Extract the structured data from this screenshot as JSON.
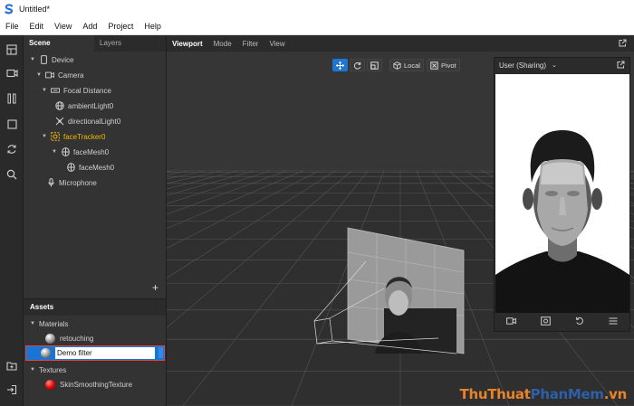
{
  "window": {
    "title": "Untitled*"
  },
  "menu": [
    "File",
    "Edit",
    "View",
    "Add",
    "Project",
    "Help"
  ],
  "scene_panel": {
    "tabs": [
      "Scene",
      "Layers"
    ],
    "tree": [
      {
        "label": "Device",
        "depth": 0,
        "icon": "device-icon",
        "expanded": true
      },
      {
        "label": "Camera",
        "depth": 1,
        "icon": "camera-icon",
        "expanded": true
      },
      {
        "label": "Focal Distance",
        "depth": 2,
        "icon": "focal-distance-icon",
        "expanded": true
      },
      {
        "label": "ambientLight0",
        "depth": 3,
        "icon": "ambient-light-icon"
      },
      {
        "label": "directionalLight0",
        "depth": 3,
        "icon": "directional-light-icon"
      },
      {
        "label": "faceTracker0",
        "depth": 2,
        "icon": "face-tracker-icon",
        "expanded": true,
        "selected": true
      },
      {
        "label": "faceMesh0",
        "depth": 3,
        "icon": "face-mesh-icon",
        "expanded": true
      },
      {
        "label": "faceMesh0",
        "depth": 4,
        "icon": "face-mesh-icon"
      },
      {
        "label": "Microphone",
        "depth": 1,
        "icon": "microphone-icon"
      }
    ],
    "add_label": "+"
  },
  "assets_panel": {
    "title": "Assets",
    "materials_label": "Materials",
    "materials": [
      {
        "label": "retouching"
      }
    ],
    "editing_value": "Demo filter",
    "textures_label": "Textures",
    "textures": [
      {
        "label": "SkinSmoothingTexture"
      }
    ]
  },
  "viewport": {
    "tabs": [
      "Viewport",
      "Mode",
      "Filter",
      "View"
    ],
    "local_label": "Local",
    "pivot_label": "Pivot",
    "preview_label": "User (Sharing)"
  },
  "watermark": {
    "part1": "ThuThuat",
    "part2": "PhanMem",
    "part3": ".vn"
  },
  "colors": {
    "selected": "#f2b800",
    "accent": "#1f76d2",
    "edit_border": "#e44444"
  }
}
